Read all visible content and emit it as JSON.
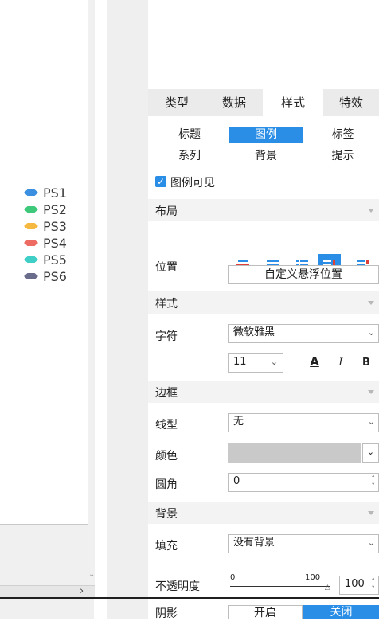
{
  "legend": {
    "items": [
      {
        "label": "PS1",
        "color": "#3b8fe0"
      },
      {
        "label": "PS2",
        "color": "#3ec97a"
      },
      {
        "label": "PS3",
        "color": "#f5b942"
      },
      {
        "label": "PS4",
        "color": "#ee6b63"
      },
      {
        "label": "PS5",
        "color": "#3fcfc6"
      },
      {
        "label": "PS6",
        "color": "#6a6c8c"
      }
    ]
  },
  "tabs": [
    "类型",
    "数据",
    "样式",
    "特效"
  ],
  "active_tab": "样式",
  "subtabs": [
    "标题",
    "图例",
    "标签",
    "系列",
    "背景",
    "提示"
  ],
  "active_subtab": "图例",
  "legend_visible": {
    "label": "图例可见",
    "checked": true
  },
  "sections": {
    "layout": "布局",
    "style": "样式",
    "border": "边框",
    "background": "背景"
  },
  "layout": {
    "position_label": "位置",
    "custom_float_button": "自定义悬浮位置"
  },
  "style": {
    "font_label": "字符",
    "font_value": "微软雅黑",
    "size_value": "11",
    "italic": "I",
    "bold": "B",
    "underline": "A"
  },
  "border": {
    "line_label": "线型",
    "line_value": "无",
    "color_label": "颜色",
    "radius_label": "圆角",
    "radius_value": "0"
  },
  "background": {
    "fill_label": "填充",
    "fill_value": "没有背景",
    "opacity_label": "不透明度",
    "opacity_min": "0",
    "opacity_max": "100",
    "opacity_value": "100",
    "shadow_label": "阴影",
    "shadow_on": "开启",
    "shadow_off": "关闭"
  }
}
